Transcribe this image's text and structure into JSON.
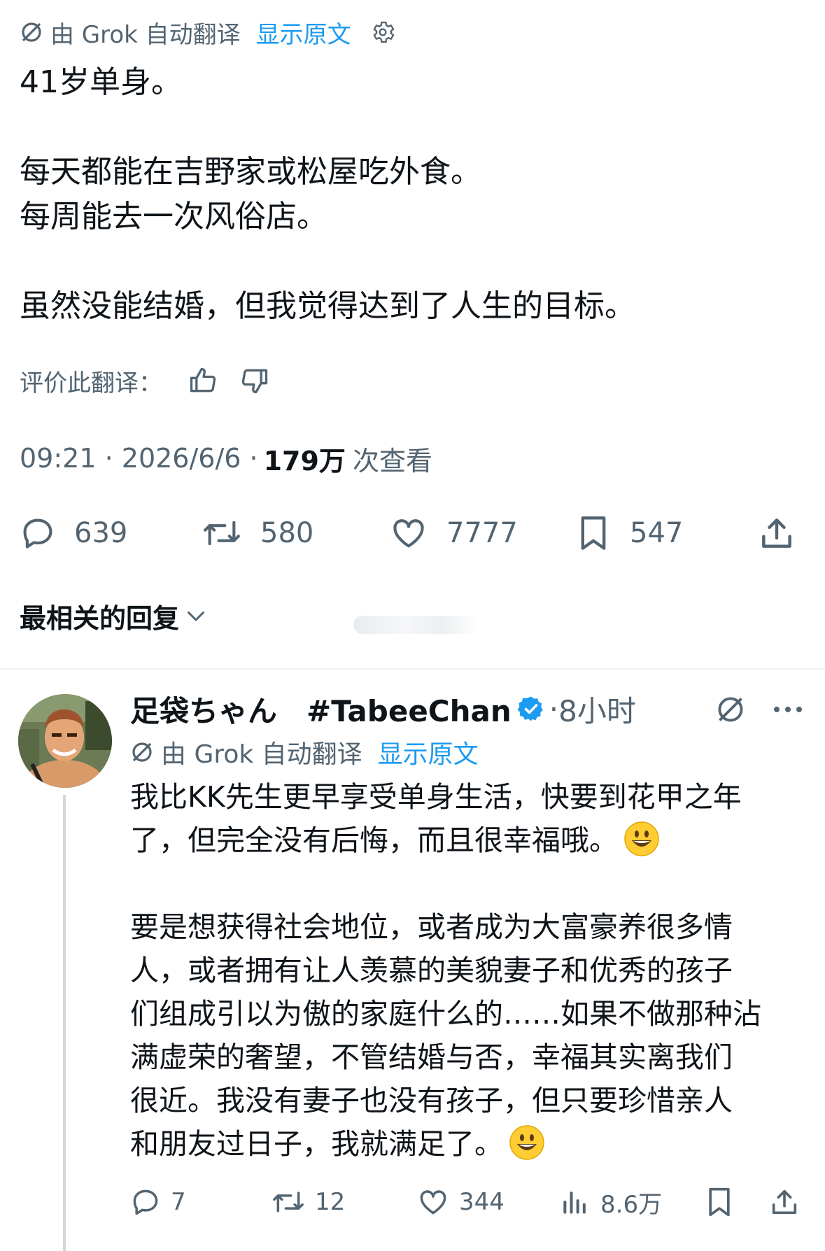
{
  "tweet": {
    "translation_bar": {
      "by_label": "由 Grok 自动翻译",
      "show_original": "显示原文"
    },
    "text_paragraphs": [
      "41岁单身。",
      "",
      "每天都能在吉野家或松屋吃外食。",
      "每周能去一次风俗店。",
      "",
      "虽然没能结婚，但我觉得达到了人生的目标。"
    ],
    "rate_label": "评价此翻译：",
    "time": "09:21",
    "date": "2026/6/6",
    "views": "179万",
    "views_label": "次查看",
    "actions": {
      "replies": "639",
      "retweets": "580",
      "likes": "7777",
      "bookmarks": "547"
    }
  },
  "replies_sort": {
    "label": "最相关的回复"
  },
  "reply": {
    "display_name": "足袋ちゃん　#TabeeChan",
    "time": "8小时",
    "translation_bar": {
      "by_label": "由 Grok 自动翻译",
      "show_original": "显示原文"
    },
    "text_paragraphs": [
      "我比KK先生更早享受单身生活，快要到花甲之年",
      "了，但完全没有后悔，而且很幸福哦。",
      "",
      "要是想获得社会地位，或者成为大富豪养很多情",
      "人，或者拥有让人羡慕的美貌妻子和优秀的孩子",
      "们组成引以为傲的家庭什么的……如果不做那种沾",
      "满虚荣的奢望，不管结婚与否，幸福其实离我们",
      "很近。我没有妻子也没有孩子，但只要珍惜亲人",
      "和朋友过日子，我就满足了。"
    ],
    "actions": {
      "replies": "7",
      "retweets": "12",
      "likes": "344",
      "views": "8.6万"
    }
  },
  "colors": {
    "link_blue": "#1d9bf0",
    "secondary_grey": "#536471",
    "text": "#0f1419"
  }
}
